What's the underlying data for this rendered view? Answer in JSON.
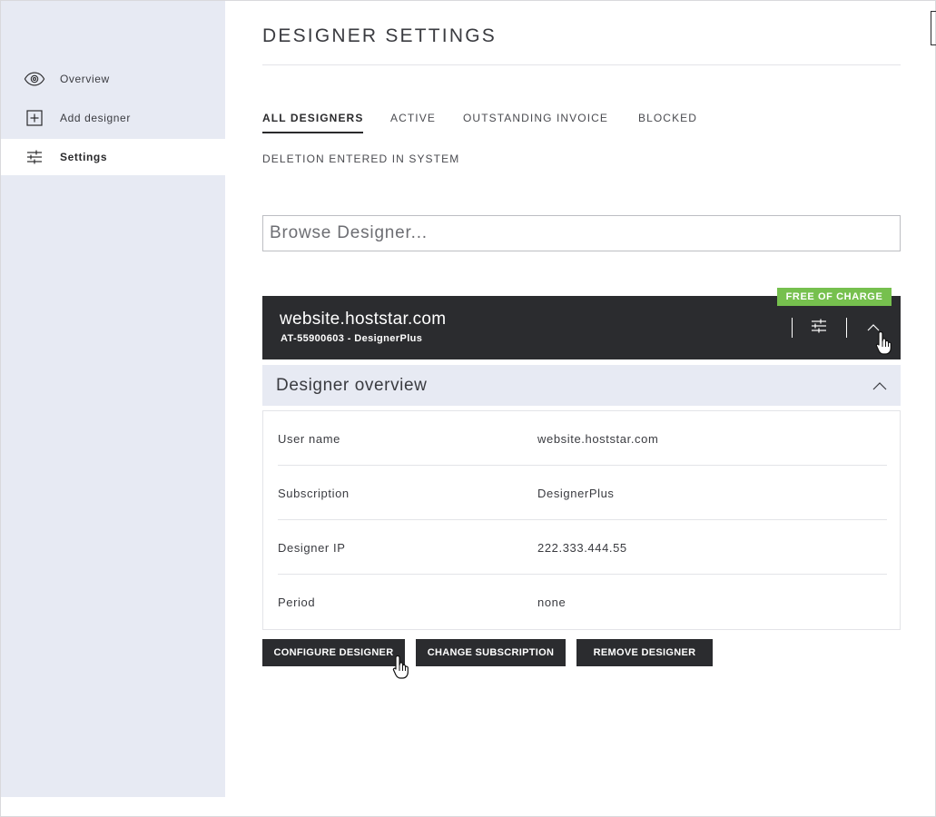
{
  "sidebar": {
    "items": [
      {
        "label": "Overview",
        "icon": "eye-icon",
        "active": false
      },
      {
        "label": "Add designer",
        "icon": "plus-square-icon",
        "active": false
      },
      {
        "label": "Settings",
        "icon": "sliders-icon",
        "active": true
      }
    ]
  },
  "header": {
    "title": "DESIGNER SETTINGS"
  },
  "tabs": [
    {
      "label": "ALL DESIGNERS",
      "active": true
    },
    {
      "label": "ACTIVE",
      "active": false
    },
    {
      "label": "OUTSTANDING INVOICE",
      "active": false
    },
    {
      "label": "BLOCKED",
      "active": false
    },
    {
      "label": "DELETION ENTERED IN SYSTEM",
      "active": false
    }
  ],
  "search": {
    "placeholder": "Browse Designer..."
  },
  "designer": {
    "badge": "FREE OF CHARGE",
    "name": "website.hoststar.com",
    "subtitle": "AT-55900603 - DesignerPlus",
    "settings_icon": "sliders-icon",
    "collapse_icon": "chevron-up-icon"
  },
  "overview": {
    "title": "Designer overview",
    "rows": [
      {
        "label": "User name",
        "value": "website.hoststar.com"
      },
      {
        "label": "Subscription",
        "value": "DesignerPlus"
      },
      {
        "label": "Designer IP",
        "value": "222.333.444.55"
      },
      {
        "label": "Period",
        "value": "none"
      }
    ]
  },
  "actions": {
    "configure": "CONFIGURE DESIGNER",
    "change_subscription": "CHANGE SUBSCRIPTION",
    "remove": "REMOVE DESIGNER"
  },
  "colors": {
    "sidebar_bg": "#e7eaf3",
    "dark": "#2b2c2f",
    "badge_green": "#76c04e",
    "border": "#bdbec3"
  }
}
